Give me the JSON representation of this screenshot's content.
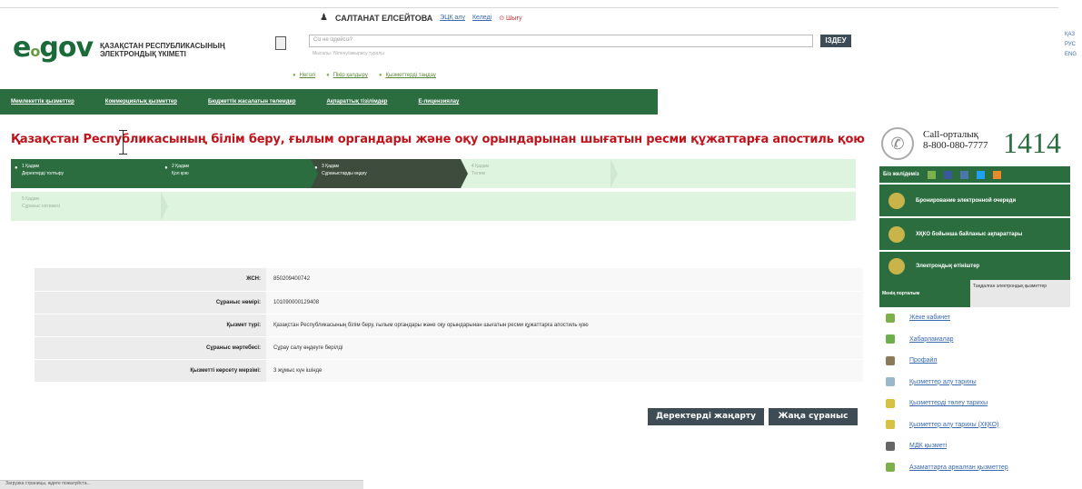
{
  "header": {
    "logo_main": "e",
    "logo_gov": "gov",
    "logo_text": "ҚАЗАҚСТАН РЕСПУБЛИКАСЫНЫҢ ЭЛЕКТРОНДЫҚ ҮКІМЕТІ",
    "user_name": "САЛТАНАТ ЕЛСЕЙТОВА",
    "user_links": [
      "ЭЦҚ алу",
      "Келеді"
    ],
    "exit_label": "Шығу",
    "search_placeholder": "Сіз не іздейсіз?",
    "search_hint": "Мысалы: Үйлену/ажырасу туралы",
    "search_button": "ІЗДЕУ",
    "quick_links": [
      "Негізгі",
      "Пікір қалдыру",
      "Қызметтерді таңдау"
    ],
    "lang": [
      "ҚАЗ",
      "РУС",
      "ENG"
    ]
  },
  "nav": {
    "items": [
      "Мемлекеттік қызметтер",
      "Коммерциялық қызметтер",
      "Бюджеттік жасалатын төлемдер",
      "Ақпараттық тізілімдер",
      "E-лицензиялау"
    ]
  },
  "page": {
    "title": "Қазақстан Республикасының білім беру, ғылым органдары және оқу орындарынан шығатын ресми құжаттарға апостиль қою"
  },
  "steps": {
    "row1": [
      {
        "num": "1 Қадам",
        "label": "Деректерді толтыру"
      },
      {
        "num": "2 Қадам",
        "label": "Қол қою"
      },
      {
        "num": "3 Қадам",
        "label": "Сұраныстарды өңдеу"
      },
      {
        "num": "4 Қадам",
        "label": "Төлем"
      }
    ],
    "row2": [
      {
        "num": "5 Қадам",
        "label": "Сұраныс нәтижесі"
      }
    ]
  },
  "info": [
    {
      "key": "ЖСН:",
      "value": "850209400742"
    },
    {
      "key": "Сұраныс нөмірі:",
      "value": "101090000129408"
    },
    {
      "key": "Қызмет түрі:",
      "value": "Қазақстан Республикасының білім беру, ғылым органдары және оқу орындарынан шығатын ресми құжаттарға апостиль қою"
    },
    {
      "key": "Сұраныс мәртебесі:",
      "value": "Сұрау салу өңдеуге берілді"
    },
    {
      "key": "Қызметті көрсету мерзімі:",
      "value": "3 жұмыс күн ішінде"
    }
  ],
  "buttons": {
    "refresh": "Деректерді жаңарту",
    "new_request": "Жаңа сұраныс"
  },
  "statusbar": "Загрузка страницы, ждите пожалуйста...",
  "sidebar": {
    "call_label_1": "Call-орталық",
    "call_label_2": "8-800-080-7777",
    "call_number": "1414",
    "social_label": "Біз желідеміз",
    "promos": [
      "Бронирование электронной очереди",
      "ХҚКО бойынша байланыс ақпараттары",
      "Электрондық өтініштер"
    ],
    "tab_on": "Менің порталым",
    "tab_off": "Таңдалған электрондық қызметтер",
    "links": [
      "Жеке кабинет",
      "Хабарламалар",
      "Профайл",
      "Қызметтер алу тарихы",
      "Қызметтерді төлеу тарихы",
      "Қызметтер алу тарихы (ХҚКО)",
      "МДК қызметі",
      "Азаматтарға арналған қызметтер"
    ]
  },
  "colors": {
    "brand_green": "#2b6d3f",
    "title_red": "#c0141c",
    "button_dark": "#3e4c56"
  }
}
